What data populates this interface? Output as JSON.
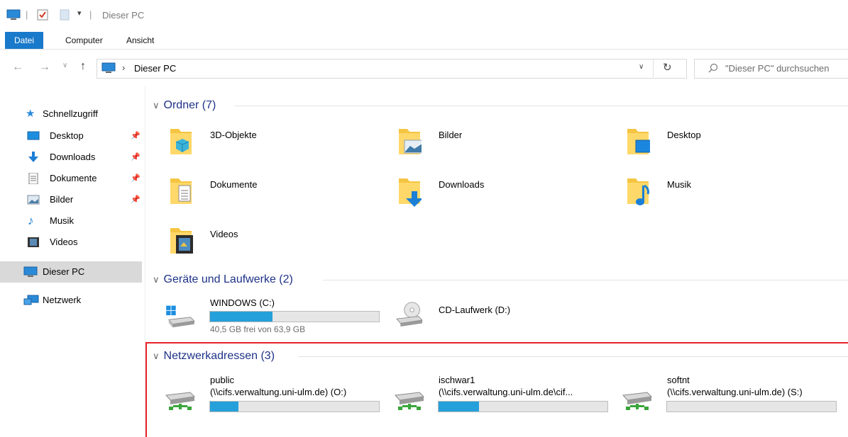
{
  "window": {
    "title": "Dieser PC"
  },
  "ribbon": {
    "tabs": [
      "Datei",
      "Computer",
      "Ansicht"
    ]
  },
  "nav": {
    "address_path": "Dieser PC",
    "search_placeholder": "\"Dieser PC\" durchsuchen"
  },
  "sidebar": {
    "quick_access": "Schnellzugriff",
    "items": [
      {
        "label": "Desktop",
        "icon": "desktop-icon",
        "pinned": true
      },
      {
        "label": "Downloads",
        "icon": "downloads-icon",
        "pinned": true
      },
      {
        "label": "Dokumente",
        "icon": "documents-icon",
        "pinned": true
      },
      {
        "label": "Bilder",
        "icon": "pictures-icon",
        "pinned": true
      },
      {
        "label": "Musik",
        "icon": "music-icon",
        "pinned": false
      },
      {
        "label": "Videos",
        "icon": "videos-icon",
        "pinned": false
      }
    ],
    "this_pc": "Dieser PC",
    "network": "Netzwerk"
  },
  "sections": {
    "folders": {
      "title": "Ordner (7)",
      "items": [
        {
          "label": "3D-Objekte",
          "icon": "3d-objects-folder-icon"
        },
        {
          "label": "Bilder",
          "icon": "pictures-folder-icon"
        },
        {
          "label": "Desktop",
          "icon": "desktop-folder-icon"
        },
        {
          "label": "Dokumente",
          "icon": "documents-folder-icon"
        },
        {
          "label": "Downloads",
          "icon": "downloads-folder-icon"
        },
        {
          "label": "Musik",
          "icon": "music-folder-icon"
        },
        {
          "label": "Videos",
          "icon": "videos-folder-icon"
        }
      ]
    },
    "devices": {
      "title": "Geräte und Laufwerke (2)",
      "items": [
        {
          "label": "WINDOWS (C:)",
          "detail": "40,5 GB frei von 63,9 GB",
          "used_fraction": 0.37,
          "icon": "windows-drive-icon"
        },
        {
          "label": "CD-Laufwerk (D:)",
          "icon": "cd-drive-icon"
        }
      ]
    },
    "network": {
      "title": "Netzwerkadressen (3)",
      "items": [
        {
          "label": "public",
          "path": "(\\\\cifs.verwaltung.uni-ulm.de) (O:)",
          "used_fraction": 0.17,
          "icon": "network-drive-icon"
        },
        {
          "label": "ischwar1",
          "path": "(\\\\cifs.verwaltung.uni-ulm.de\\cif...",
          "used_fraction": 0.24,
          "icon": "network-drive-icon"
        },
        {
          "label": "softnt",
          "path": "(\\\\cifs.verwaltung.uni-ulm.de) (S:)",
          "used_fraction": 0.0,
          "icon": "network-drive-icon"
        }
      ]
    }
  },
  "colors": {
    "accent": "#1979ca",
    "bar_fill": "#26a0da",
    "highlight": "#e8222a",
    "section_title": "#1e3287"
  }
}
